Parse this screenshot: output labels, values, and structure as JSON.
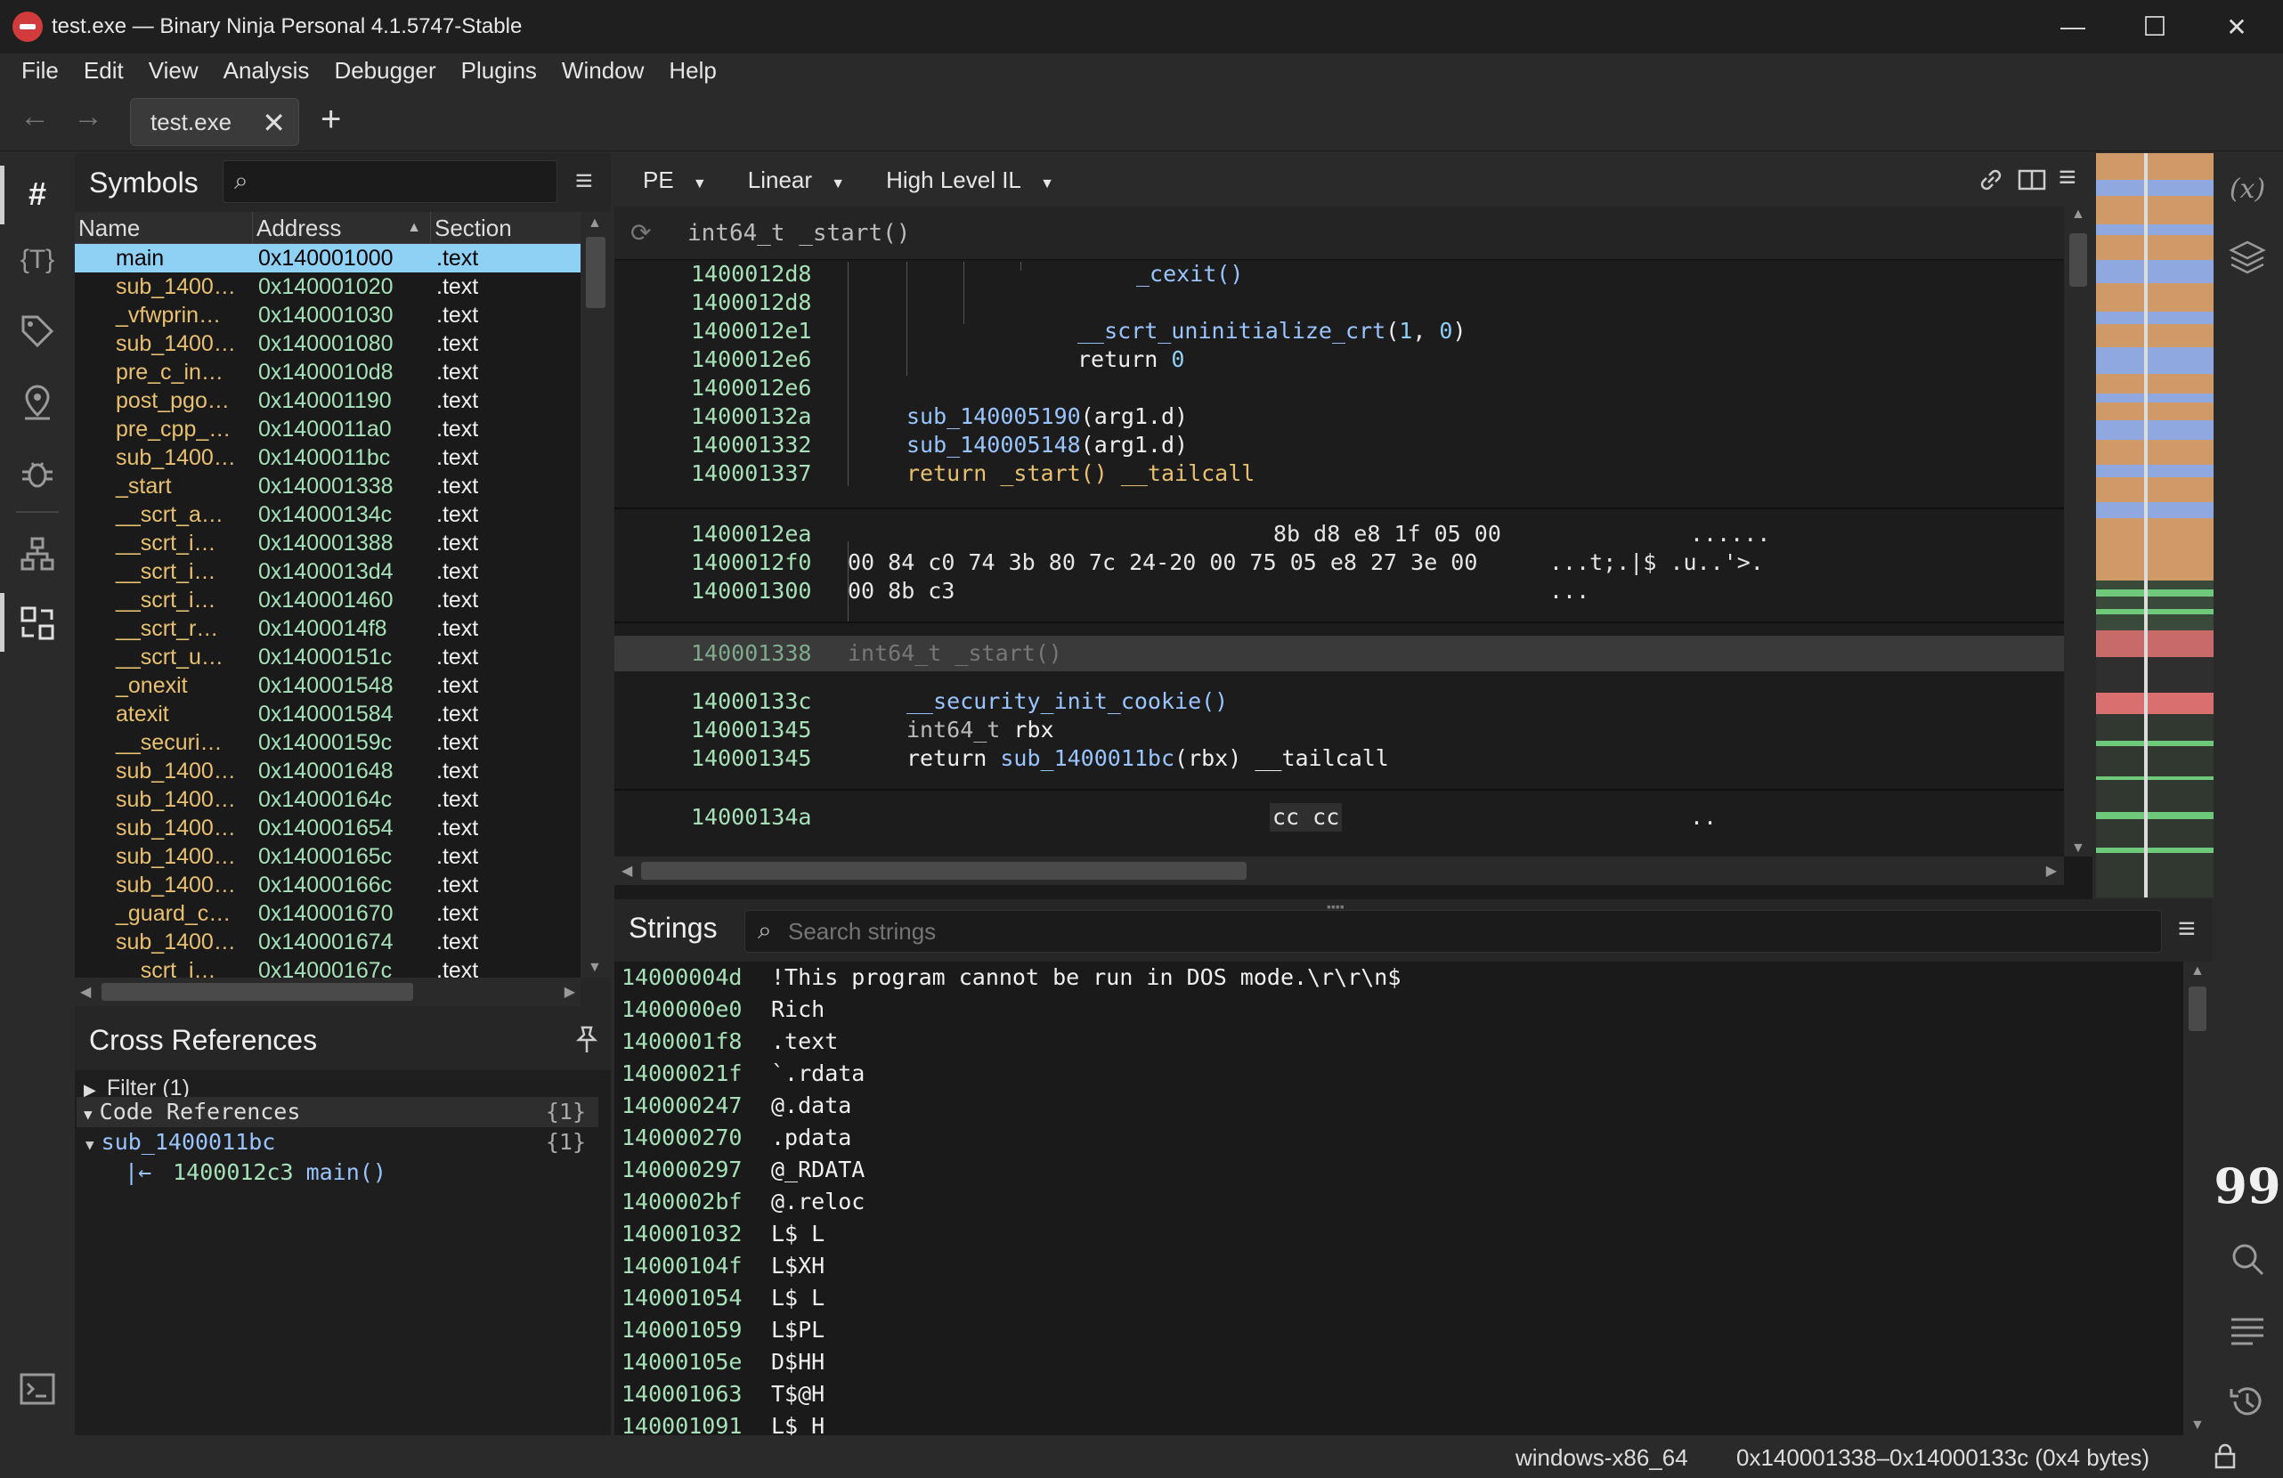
{
  "window": {
    "title": "test.exe — Binary Ninja Personal 4.1.5747-Stable",
    "minimize": "—",
    "maximize": "☐",
    "close": "✕"
  },
  "menu": [
    "File",
    "Edit",
    "View",
    "Analysis",
    "Debugger",
    "Plugins",
    "Window",
    "Help"
  ],
  "tabs": {
    "active": "test.exe",
    "close_glyph": "✕",
    "new_glyph": "+"
  },
  "symbols": {
    "title": "Symbols",
    "search_placeholder": "",
    "columns": [
      "Name",
      "Address",
      "Section"
    ],
    "sort_glyph": "▲",
    "rows": [
      {
        "name": "main",
        "address": "0x140001000",
        "section": ".text"
      },
      {
        "name": "sub_1400…",
        "address": "0x140001020",
        "section": ".text"
      },
      {
        "name": "_vfwprin…",
        "address": "0x140001030",
        "section": ".text"
      },
      {
        "name": "sub_1400…",
        "address": "0x140001080",
        "section": ".text"
      },
      {
        "name": "pre_c_in…",
        "address": "0x1400010d8",
        "section": ".text"
      },
      {
        "name": "post_pgo…",
        "address": "0x140001190",
        "section": ".text"
      },
      {
        "name": "pre_cpp_…",
        "address": "0x1400011a0",
        "section": ".text"
      },
      {
        "name": "sub_1400…",
        "address": "0x1400011bc",
        "section": ".text"
      },
      {
        "name": "_start",
        "address": "0x140001338",
        "section": ".text"
      },
      {
        "name": "__scrt_a…",
        "address": "0x14000134c",
        "section": ".text"
      },
      {
        "name": "__scrt_i…",
        "address": "0x140001388",
        "section": ".text"
      },
      {
        "name": "__scrt_i…",
        "address": "0x1400013d4",
        "section": ".text"
      },
      {
        "name": "__scrt_i…",
        "address": "0x140001460",
        "section": ".text"
      },
      {
        "name": "__scrt_r…",
        "address": "0x1400014f8",
        "section": ".text"
      },
      {
        "name": "__scrt_u…",
        "address": "0x14000151c",
        "section": ".text"
      },
      {
        "name": "_onexit",
        "address": "0x140001548",
        "section": ".text"
      },
      {
        "name": "atexit",
        "address": "0x140001584",
        "section": ".text"
      },
      {
        "name": "__securi…",
        "address": "0x14000159c",
        "section": ".text"
      },
      {
        "name": "sub_1400…",
        "address": "0x140001648",
        "section": ".text"
      },
      {
        "name": "sub_1400…",
        "address": "0x14000164c",
        "section": ".text"
      },
      {
        "name": "sub_1400…",
        "address": "0x140001654",
        "section": ".text"
      },
      {
        "name": "sub_1400…",
        "address": "0x14000165c",
        "section": ".text"
      },
      {
        "name": "sub_1400…",
        "address": "0x14000166c",
        "section": ".text"
      },
      {
        "name": "_guard_c…",
        "address": "0x140001670",
        "section": ".text"
      },
      {
        "name": "sub_1400…",
        "address": "0x140001674",
        "section": ".text"
      },
      {
        "name": "__scrt_i…",
        "address": "0x14000167c",
        "section": ".text"
      }
    ]
  },
  "xrefs": {
    "title": "Cross References",
    "filter": "Filter (1)",
    "code_refs": "Code References",
    "code_refs_count": "{1}",
    "func": "sub_1400011bc",
    "func_count": "{1}",
    "ref_addr": "1400012c3",
    "ref_text": "main()"
  },
  "view": {
    "type": "PE",
    "layout": "Linear",
    "il": "High Level IL",
    "func_header": "int64_t _start()"
  },
  "code": {
    "lines": [
      {
        "addr": "1400012d8",
        "text": "_cexit()"
      },
      {
        "addr": "1400012d8",
        "text": ""
      },
      {
        "addr": "1400012e1",
        "text": "__scrt_uninitialize_crt(1, 0)"
      },
      {
        "addr": "1400012e6",
        "text": "return 0"
      },
      {
        "addr": "1400012e6",
        "text": ""
      },
      {
        "addr": "14000132a",
        "text": "sub_140005190(arg1.d)"
      },
      {
        "addr": "140001332",
        "text": "sub_140005148(arg1.d)"
      },
      {
        "addr": "140001337",
        "text": "return _start() __tailcall"
      }
    ],
    "hex": [
      {
        "addr": "1400012ea",
        "bytes": "8b d8 e8 1f 05 00",
        "ascii": "......"
      },
      {
        "addr": "1400012f0",
        "bytes": "00 84 c0 74 3b 80 7c 24-20 00 75 05 e8 27 3e 00",
        "ascii": "...t;.|$ .u..'>."
      },
      {
        "addr": "140001300",
        "bytes": "00 8b c3",
        "ascii": "..."
      }
    ],
    "func2_addr": "140001338",
    "func2_header": "int64_t _start()",
    "lines2": [
      {
        "addr": "14000133c",
        "text": "__security_init_cookie()"
      },
      {
        "addr": "140001345",
        "text": "int64_t rbx"
      },
      {
        "addr": "140001345",
        "text": "return sub_1400011bc(rbx) __tailcall"
      }
    ],
    "hex2": {
      "addr": "14000134a",
      "bytes": "cc cc",
      "ascii": ".."
    }
  },
  "strings": {
    "title": "Strings",
    "search_placeholder": "Search strings",
    "rows": [
      {
        "addr": "14000004d",
        "value": "!This program cannot be run in DOS mode.\\r\\r\\n$"
      },
      {
        "addr": "1400000e0",
        "value": "Rich"
      },
      {
        "addr": "1400001f8",
        "value": ".text"
      },
      {
        "addr": "14000021f",
        "value": "`.rdata"
      },
      {
        "addr": "140000247",
        "value": "@.data"
      },
      {
        "addr": "140000270",
        "value": ".pdata"
      },
      {
        "addr": "140000297",
        "value": "@_RDATA"
      },
      {
        "addr": "1400002bf",
        "value": "@.reloc"
      },
      {
        "addr": "140001032",
        "value": "L$ L"
      },
      {
        "addr": "14000104f",
        "value": "L$XH"
      },
      {
        "addr": "140001054",
        "value": "L$ L"
      },
      {
        "addr": "140001059",
        "value": "L$PL"
      },
      {
        "addr": "14000105e",
        "value": "D$HH"
      },
      {
        "addr": "140001063",
        "value": "T$@H"
      },
      {
        "addr": "140001091",
        "value": "L$ H"
      }
    ]
  },
  "status": {
    "platform": "windows-x86_64",
    "range": "0x140001338–0x14000133c (0x4 bytes)"
  },
  "colors": {
    "address": "#a6e1b8",
    "function": "#99c4ff",
    "selection": "#8fd0f5",
    "symbol_name": "#e8c070"
  }
}
